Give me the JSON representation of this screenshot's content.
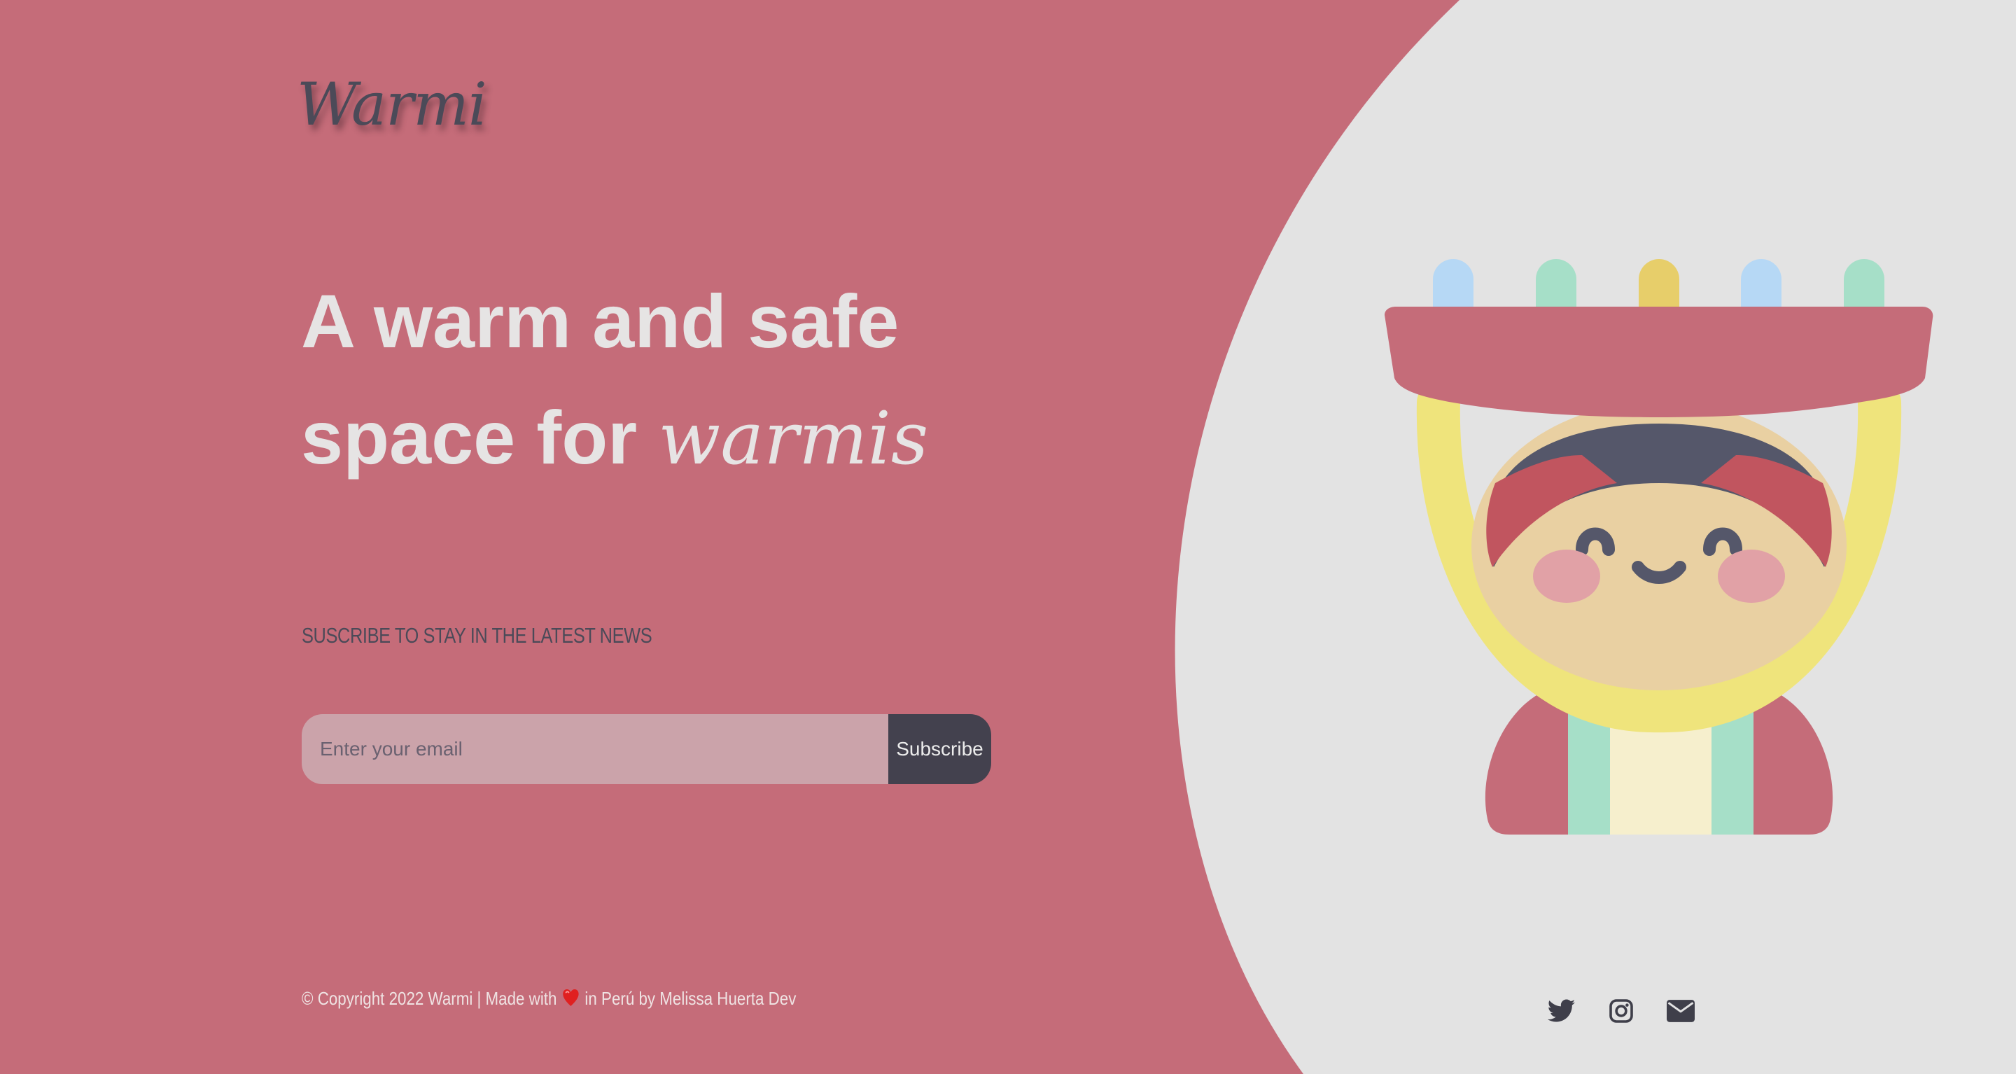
{
  "brand": {
    "logo_text": "Warmi"
  },
  "hero": {
    "headline_line1": "A warm and safe",
    "headline_line2_prefix": "space for ",
    "headline_accent": "warmis"
  },
  "newsletter": {
    "label": "SUSCRIBE TO STAY IN THE LATEST NEWS",
    "email_placeholder": "Enter your email",
    "email_value": "",
    "button_label": "Subscribe"
  },
  "footer": {
    "copyright_prefix": "© Copyright 2022 Warmi | Made with",
    "copyright_suffix": "in Perú by Melissa Huerta Dev",
    "heart_icon": "heart-icon"
  },
  "social": {
    "icons": [
      "twitter-icon",
      "instagram-icon",
      "envelope-icon"
    ]
  },
  "colors": {
    "primary": "#c56c79",
    "panel": "#e3e3e3",
    "dark": "#43414e",
    "input": "#cba3aa",
    "text_light": "#e6e4e4"
  }
}
